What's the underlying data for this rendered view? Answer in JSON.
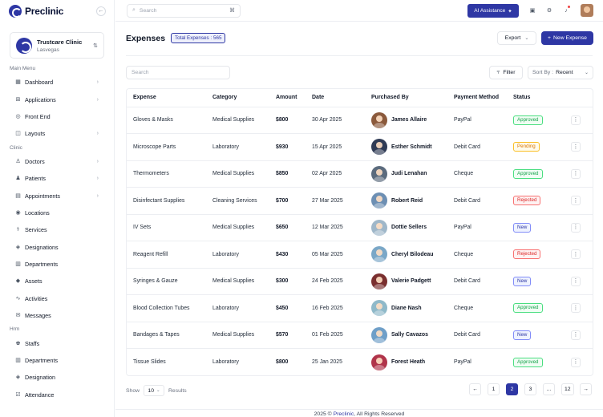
{
  "brand": {
    "name": "Preclinic"
  },
  "clinic": {
    "name": "Trustcare Clinic",
    "location": "Lasvegas"
  },
  "sidebar": {
    "sections": [
      {
        "label": "Main Menu",
        "items": [
          {
            "label": "Dashboard",
            "icon": "grid-icon",
            "chevron": true
          },
          {
            "label": "Applications",
            "icon": "apps-icon",
            "chevron": true
          },
          {
            "label": "Front End",
            "icon": "globe-icon",
            "chevron": false
          },
          {
            "label": "Layouts",
            "icon": "layout-icon",
            "chevron": true
          }
        ]
      },
      {
        "label": "Clinic",
        "items": [
          {
            "label": "Doctors",
            "icon": "doctor-icon",
            "chevron": true
          },
          {
            "label": "Patients",
            "icon": "patient-icon",
            "chevron": true
          },
          {
            "label": "Appointments",
            "icon": "calendar-icon",
            "chevron": true
          },
          {
            "label": "Locations",
            "icon": "location-icon",
            "chevron": false
          },
          {
            "label": "Services",
            "icon": "services-icon",
            "chevron": false
          },
          {
            "label": "Designations",
            "icon": "designation-icon",
            "chevron": false
          },
          {
            "label": "Departments",
            "icon": "department-icon",
            "chevron": false
          },
          {
            "label": "Assets",
            "icon": "asset-icon",
            "chevron": false
          },
          {
            "label": "Activities",
            "icon": "activity-icon",
            "chevron": false
          },
          {
            "label": "Messages",
            "icon": "message-icon",
            "chevron": false
          }
        ]
      },
      {
        "label": "Hrm",
        "items": [
          {
            "label": "Staffs",
            "icon": "staff-icon",
            "chevron": false
          },
          {
            "label": "Departments",
            "icon": "department-icon",
            "chevron": false
          },
          {
            "label": "Designation",
            "icon": "designation-icon",
            "chevron": false
          },
          {
            "label": "Attendance",
            "icon": "attendance-icon",
            "chevron": false
          }
        ]
      }
    ]
  },
  "topbar": {
    "search_placeholder": "Search",
    "shortcut": "⌘",
    "ai_label": "AI Assistance"
  },
  "page": {
    "title": "Expenses",
    "total_badge": "Total Expenses : 565",
    "export_label": "Export",
    "new_label": "New Expense",
    "table_search_placeholder": "Search",
    "filter_label": "Filter",
    "sort_prefix": "Sort By :",
    "sort_value": "Recent"
  },
  "table": {
    "columns": [
      "Expense",
      "Category",
      "Amount",
      "Date",
      "Purchased By",
      "Payment Method",
      "Status"
    ],
    "rows": [
      {
        "expense": "Gloves & Masks",
        "category": "Medical Supplies",
        "amount": "$800",
        "date": "30 Apr 2025",
        "purchaser": "James Allaire",
        "avatar_color": "#8b5a3c",
        "payment": "PayPal",
        "status": "Approved"
      },
      {
        "expense": "Microscope Parts",
        "category": "Laboratory",
        "amount": "$930",
        "date": "15 Apr 2025",
        "purchaser": "Esther Schmidt",
        "avatar_color": "#2f3b55",
        "payment": "Debit Card",
        "status": "Pending"
      },
      {
        "expense": "Thermometers",
        "category": "Medical Supplies",
        "amount": "$850",
        "date": "02 Apr 2025",
        "purchaser": "Judi Lenahan",
        "avatar_color": "#5b6b7d",
        "payment": "Cheque",
        "status": "Approved"
      },
      {
        "expense": "Disinfectant Supplies",
        "category": "Cleaning Services",
        "amount": "$700",
        "date": "27 Mar 2025",
        "purchaser": "Robert Reid",
        "avatar_color": "#6d8fb3",
        "payment": "Debit Card",
        "status": "Rejected"
      },
      {
        "expense": "IV Sets",
        "category": "Medical Supplies",
        "amount": "$650",
        "date": "12 Mar 2025",
        "purchaser": "Dottie Sellers",
        "avatar_color": "#9fb7c9",
        "payment": "PayPal",
        "status": "New"
      },
      {
        "expense": "Reagent Refill",
        "category": "Laboratory",
        "amount": "$430",
        "date": "05 Mar 2025",
        "purchaser": "Cheryl Bilodeau",
        "avatar_color": "#7aa7c7",
        "payment": "Cheque",
        "status": "Rejected"
      },
      {
        "expense": "Syringes & Gauze",
        "category": "Medical Supplies",
        "amount": "$300",
        "date": "24 Feb 2025",
        "purchaser": "Valerie Padgett",
        "avatar_color": "#7a2f2f",
        "payment": "Debit Card",
        "status": "New"
      },
      {
        "expense": "Blood Collection Tubes",
        "category": "Laboratory",
        "amount": "$450",
        "date": "16 Feb 2025",
        "purchaser": "Diane Nash",
        "avatar_color": "#8fb9c9",
        "payment": "Cheque",
        "status": "Approved"
      },
      {
        "expense": "Bandages & Tapes",
        "category": "Medical Supplies",
        "amount": "$570",
        "date": "01 Feb 2025",
        "purchaser": "Sally Cavazos",
        "avatar_color": "#6f9fc8",
        "payment": "Debit Card",
        "status": "New"
      },
      {
        "expense": "Tissue Slides",
        "category": "Laboratory",
        "amount": "$800",
        "date": "25 Jan 2025",
        "purchaser": "Forest Heath",
        "avatar_color": "#b0344a",
        "payment": "PayPal",
        "status": "Approved"
      }
    ]
  },
  "pagination": {
    "show_label": "Show",
    "per_page": "10",
    "results_label": "Results",
    "prev": "←",
    "pages": [
      "1",
      "2",
      "3",
      "...",
      "12"
    ],
    "active_page": "2",
    "next": "→"
  },
  "footer": {
    "prefix": "2025 © ",
    "brand": "Preclinic",
    "suffix": ", All Rights Reserved"
  }
}
